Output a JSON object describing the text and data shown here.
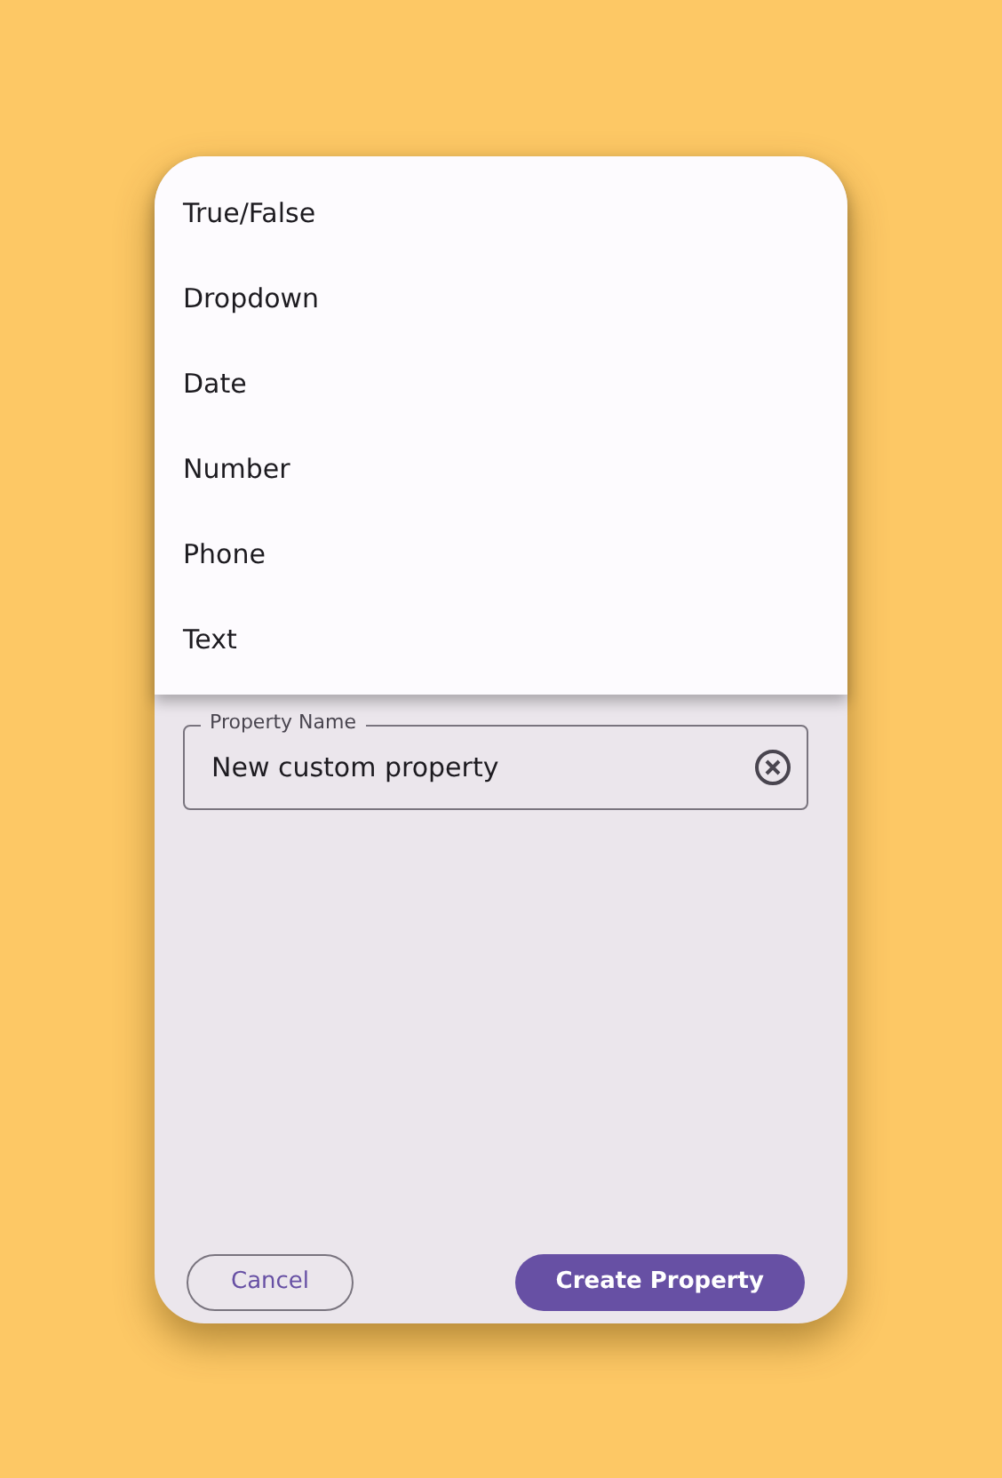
{
  "menu": {
    "items": [
      {
        "label": "True/False"
      },
      {
        "label": "Dropdown"
      },
      {
        "label": "Date"
      },
      {
        "label": "Number"
      },
      {
        "label": "Phone"
      },
      {
        "label": "Text"
      }
    ]
  },
  "field": {
    "label": "Property Name",
    "value": "New custom property"
  },
  "buttons": [
    {
      "label": "Cancel",
      "kind": "outlined"
    },
    {
      "label": "Create Property",
      "kind": "filled"
    }
  ]
}
